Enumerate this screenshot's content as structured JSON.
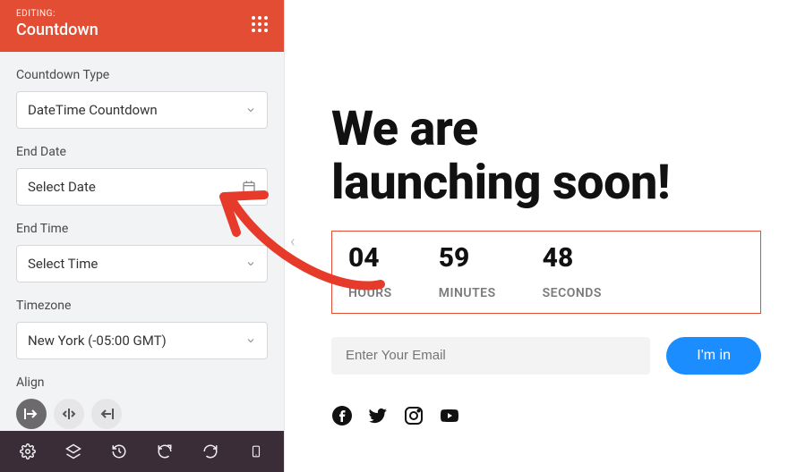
{
  "header": {
    "editing_label": "EDITING:",
    "title": "Countdown"
  },
  "fields": {
    "type_label": "Countdown Type",
    "type_value": "DateTime Countdown",
    "end_date_label": "End Date",
    "end_date_value": "Select Date",
    "end_time_label": "End Time",
    "end_time_value": "Select Time",
    "timezone_label": "Timezone",
    "timezone_value": "New York (-05:00 GMT)",
    "align_label": "Align"
  },
  "preview": {
    "heading_line1": "We are",
    "heading_line2": "launching soon!",
    "countdown": {
      "hours_value": "04",
      "hours_label": "HOURS",
      "minutes_value": "59",
      "minutes_label": "MINUTES",
      "seconds_value": "48",
      "seconds_label": "SECONDS"
    },
    "email_placeholder": "Enter Your Email",
    "cta_label": "I'm in"
  }
}
